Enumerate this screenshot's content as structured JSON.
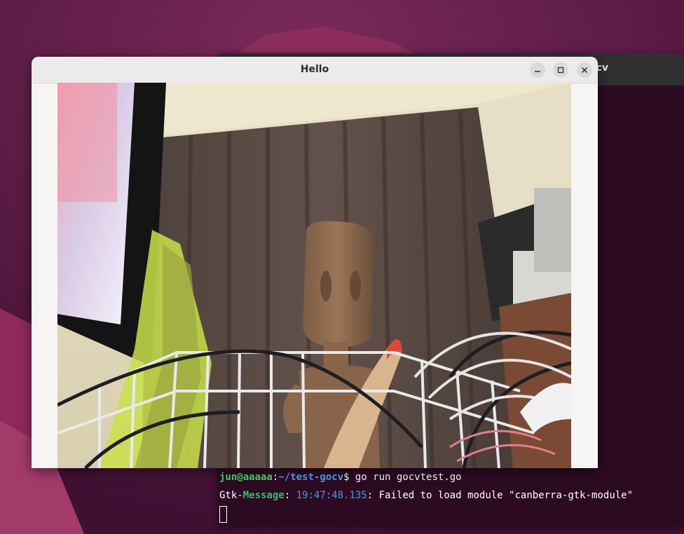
{
  "hello_window": {
    "title": "Hello",
    "controls": [
      "minimize-icon",
      "maximize-icon",
      "close-icon"
    ]
  },
  "terminal": {
    "title_fragment": "cv",
    "lines": {
      "prompt_user": "jun@aaaaa",
      "prompt_sep": ":",
      "prompt_path": "~/test-gocv",
      "prompt_symbol": "$ ",
      "command": "go run gocvtest.go",
      "gtk_prefix": "Gtk-",
      "gtk_level": "Message",
      "gtk_sep1": ": ",
      "gtk_time": "19:47:48.135",
      "gtk_text": ": Failed to load module \"canberra-gtk-module\""
    }
  },
  "colors": {
    "wallpaper": "#4f1638",
    "terminal_bg": "#2c0b22",
    "prompt_user": "#4fd36b",
    "prompt_path": "#4aa3ff",
    "gtk_message": "#2dc06a",
    "timestamp": "#3b9bea"
  }
}
